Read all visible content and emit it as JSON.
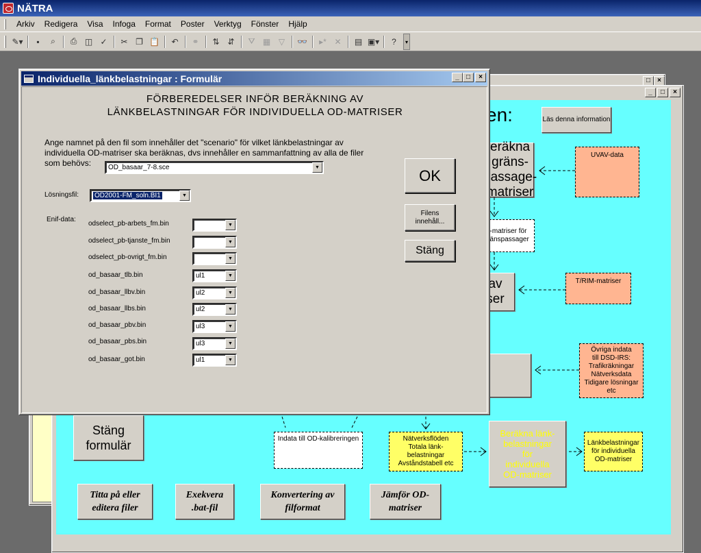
{
  "app": {
    "title": "NÄTRA"
  },
  "menu": [
    "Arkiv",
    "Redigera",
    "Visa",
    "Infoga",
    "Format",
    "Poster",
    "Verktyg",
    "Fönster",
    "Hjälp"
  ],
  "window_controls": {
    "minimize": "_",
    "maximize": "□",
    "close": "×"
  },
  "flow": {
    "heading_fragment": "en:",
    "info_button": "Läs denna information",
    "box_grans_passage": "eräkna\ngräns-\npassage-\nmatriser",
    "note_uvav": "UVAV-data",
    "note_matriser_grans": "-matriser för\nränspassager",
    "box_av_ser": "av\nser",
    "note_trim": "T/RIM-matriser",
    "note_ovriga": "Övriga indata\ntill DSD-IRS:\nTrafikräkningar\nNätverksdata\nTidigare lösningar\netc",
    "box_stang_formular": "Stäng\nformulär",
    "note_indata_od": "Indata till OD-kalibreringen",
    "note_natverksfloden": "Nätverksflöden\nTotala länk-\nbelastningar\nAvståndstabell etc",
    "box_berakna_lank": "Beräkna länk-\nbelastningar\nför\nindividuella\nOD-matriser",
    "note_lankbelastningar": "Länkbelastningar\nför individuella\nOD-matriser",
    "btn_titta": "Titta på eller\neditera filer",
    "btn_exekvera": "Exekvera\n.bat-fil",
    "btn_konvertering": "Konvertering av\nfilformat",
    "btn_jamfor": "Jämför OD-\nmatriser"
  },
  "dialog": {
    "title": "Individuella_länkbelastningar : Formulär",
    "heading_line1": "FÖRBEREDELSER INFÖR BERÄKNING AV",
    "heading_line2": "LÄNKBELASTNINGAR FÖR INDIVIDUELLA OD-MATRISER",
    "description_line1": "Ange namnet på den fil som innehåller det \"scenario\" för vilket länkbelastningar av",
    "description_line2": "individuella OD-matriser ska beräknas, dvs innehåller en sammanfattning av alla de filer",
    "description_line3": "som  behövs:",
    "scenario_value": "OD_basaar_7-8.sce",
    "losningsfil_label": "Lösningsfil:",
    "losningsfil_value": "OD2001-FM_soln.BI1",
    "enif_label": "Enif-data:",
    "enif_rows": [
      {
        "file": "odselect_pb-arbets_fm.bin",
        "value": ""
      },
      {
        "file": "odselect_pb-tjanste_fm.bin",
        "value": ""
      },
      {
        "file": "odselect_pb-ovrigt_fm.bin",
        "value": ""
      },
      {
        "file": "od_basaar_tlb.bin",
        "value": "ul1"
      },
      {
        "file": "od_basaar_llbv.bin",
        "value": "ul2"
      },
      {
        "file": "od_basaar_llbs.bin",
        "value": "ul2"
      },
      {
        "file": "od_basaar_pbv.bin",
        "value": "ul3"
      },
      {
        "file": "od_basaar_pbs.bin",
        "value": "ul3"
      },
      {
        "file": "od_basaar_got.bin",
        "value": "ul1"
      }
    ],
    "ok_label": "OK",
    "filens_label": "Filens\ninnehåll...",
    "stang_label": "Stäng"
  },
  "colors": {
    "canvas": "#66ffff",
    "peach": "#ffb591",
    "yellow": "#ffff66",
    "title_blue": "#0a246a"
  }
}
